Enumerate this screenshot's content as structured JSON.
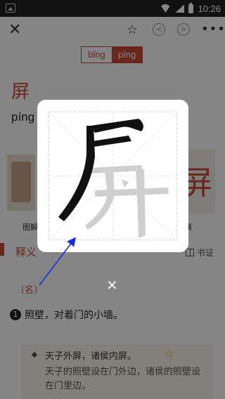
{
  "status_bar": {
    "time": "10:26",
    "icons": [
      "image-icon",
      "wifi-icon",
      "signal-icon",
      "battery-icon"
    ]
  },
  "nav": {
    "close_glyph": "✕",
    "star_glyph": "☆",
    "prev_glyph": "<",
    "next_glyph": ">",
    "more_glyph": "•••"
  },
  "pinyin_tabs": [
    "bǐng",
    "píng"
  ],
  "character": "屏",
  "pinyin_shown": "píng",
  "pictures": {
    "left_label": "图解",
    "right_label": "演",
    "right_char": "屏"
  },
  "section": {
    "title": "释义",
    "mark": "▲",
    "book_label": "书证"
  },
  "definition": {
    "pos": "〔名〕",
    "number": "1",
    "text": "照壁，对着门的小墙。"
  },
  "example": {
    "sentence": "天子外屏，诸侯内屏。",
    "star": "☆",
    "explanation": "天子的照壁设在门外边，诸侯的照壁设在门里边。"
  },
  "popup": {
    "close_glyph": "✕"
  },
  "colors": {
    "accent": "#c94a3c",
    "overlay": "rgba(0,0,0,0.48)",
    "stroke_done": "#111111",
    "stroke_pending": "#cfcfcf",
    "arrow": "#1a2ee0"
  }
}
